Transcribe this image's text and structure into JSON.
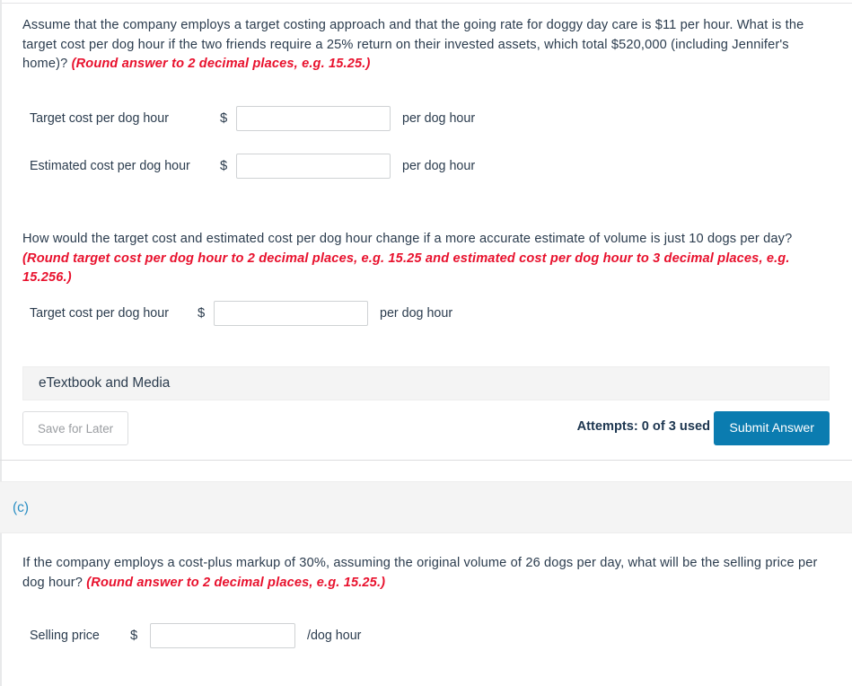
{
  "part_b": {
    "question_1": {
      "text": "Assume that the company employs a target costing approach and that the going rate for doggy day care is $11 per hour. What is the target cost per dog hour if the two friends require a 25% return on their invested assets, which total $520,000 (including Jennifer's home)? ",
      "hint": "(Round answer to 2 decimal places, e.g. 15.25.)"
    },
    "answers_1": [
      {
        "label": "Target cost per dog hour",
        "currency": "$",
        "value": "",
        "suffix": "per dog hour"
      },
      {
        "label": "Estimated cost per dog hour",
        "currency": "$",
        "value": "",
        "suffix": "per dog hour"
      }
    ],
    "question_2": {
      "text": "How would the target cost and estimated cost per dog hour change if a more accurate estimate of volume is just 10 dogs per day? ",
      "hint": "(Round target cost per dog hour to 2 decimal places, e.g. 15.25 and estimated cost per dog hour to 3 decimal places, e.g. 15.256.)"
    },
    "answers_2": [
      {
        "label": "Target cost per dog hour",
        "currency": "$",
        "value": "",
        "suffix": "per dog hour"
      }
    ],
    "etextbook_label": "eTextbook and Media",
    "save_label": "Save for Later",
    "attempts_label": "Attempts: 0 of 3 used",
    "submit_label": "Submit Answer"
  },
  "part_c": {
    "letter": "(c)",
    "question": {
      "text": "If the company employs a cost-plus markup of 30%, assuming the original volume of 26 dogs per day, what will be the selling price per dog hour? ",
      "hint": "(Round answer to 2 decimal places, e.g. 15.25.)"
    },
    "answers": [
      {
        "label": "Selling price",
        "currency": "$",
        "value": "",
        "suffix": "/dog hour"
      }
    ]
  },
  "colors": {
    "hint_red": "#e8112d",
    "submit_blue": "#0b7cb0",
    "part_letter_blue": "#2b8fc4",
    "body_text": "#2b3c4e",
    "band_gray": "#f4f4f4"
  }
}
